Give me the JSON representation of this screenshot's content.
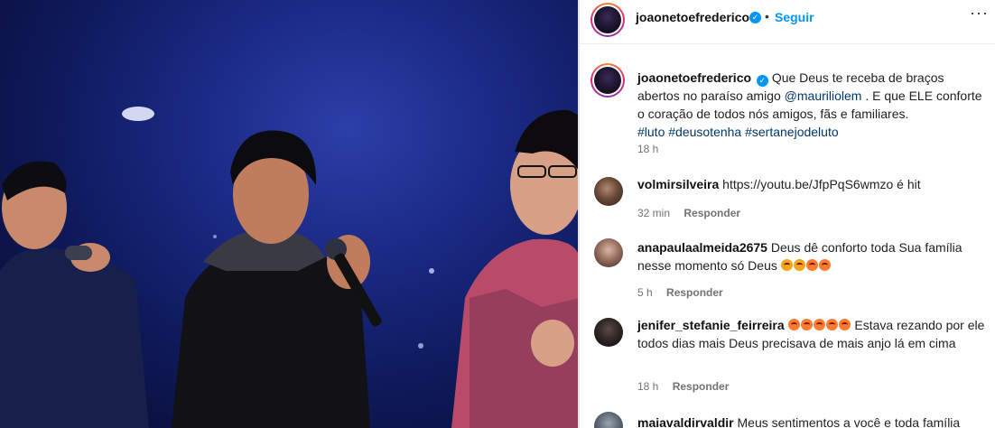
{
  "post": {
    "username": "joaonetoefrederico",
    "follow_label": "Seguir",
    "separator": "•",
    "more_label": "···"
  },
  "caption": {
    "username": "joaonetoefrederico",
    "text_before_mention": "Que Deus te receba de braços abertos no paraíso amigo",
    "mention": "@mauriliolem",
    "text_after_mention": ". E que ELE conforte o coração de todos nós amigos, fãs e familiares.",
    "hashtags": [
      "#luto",
      "#deusotenha",
      "#sertanejodeluto"
    ],
    "time": "18 h"
  },
  "comments": [
    {
      "username": "volmirsilveira",
      "text": "https://youtu.be/JfpPqS6wmzo é hit",
      "time": "32 min",
      "reply_label": "Responder"
    },
    {
      "username": "anapaulaalmeida2675",
      "text": "Deus dê conforto toda Sua família nesse momento só Deus",
      "time": "5 h",
      "reply_label": "Responder"
    },
    {
      "username": "jenifer_stefanie_feirreira",
      "text": "Estava rezando por ele todos dias mais Deus precisava de mais anjo lá em cima",
      "time": "18 h",
      "reply_label": "Responder"
    },
    {
      "username": "maiavaldirvaldir",
      "text": "Meus sentimentos a você e toda família"
    }
  ],
  "colors": {
    "accent": "#0095f6",
    "link": "#00376b",
    "muted": "#737373"
  }
}
